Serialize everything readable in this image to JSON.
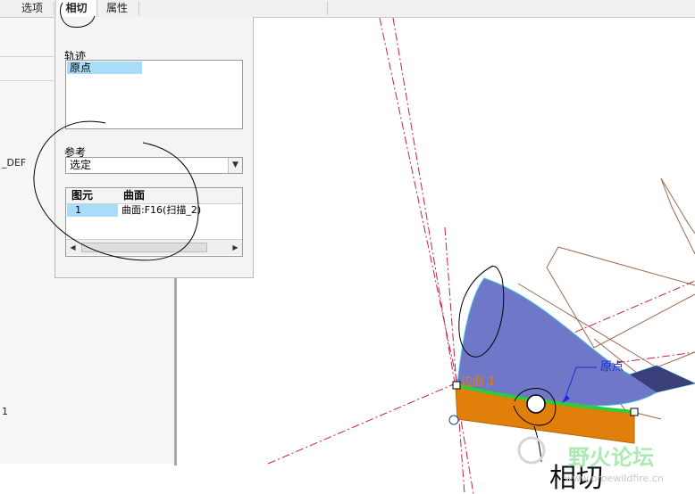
{
  "tabs": [
    {
      "label": "选项"
    },
    {
      "label": "相切"
    },
    {
      "label": "属性"
    }
  ],
  "tangency_panel": {
    "trajectory_label": "轨迹",
    "trajectory_items": [
      "原点"
    ],
    "reference_label": "参考",
    "reference_value": "选定",
    "table": {
      "headers": [
        "图元",
        "曲面"
      ],
      "rows": [
        [
          "1",
          "曲面:F16(扫描_2)"
        ]
      ]
    }
  },
  "left_pane": {
    "fragment_def": "_DEF",
    "fragment_one": "1"
  },
  "viewport": {
    "label_face": "边面 1",
    "label_origin": "原点",
    "annotation_text": "相切"
  },
  "watermark": {
    "name": "野火论坛",
    "url": "www.proewildfire.cn"
  },
  "colors": {
    "orange_surface": "#e0800a",
    "blue_surface": "#6f78c8",
    "green_edge": "#2ecc3a",
    "selection": "#a8dcf8",
    "datum_red": "#c02040"
  }
}
